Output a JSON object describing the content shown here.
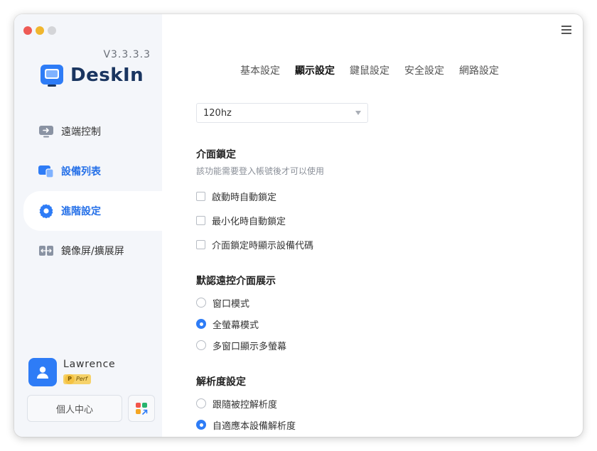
{
  "app": {
    "version": "V3.3.3.3",
    "brand_name": "DeskIn",
    "brand_color": "#2e7cf6"
  },
  "sidebar": {
    "items": [
      {
        "label": "遠端控制",
        "icon": "remote-screen-icon"
      },
      {
        "label": "設備列表",
        "icon": "devices-icon"
      },
      {
        "label": "進階設定",
        "icon": "gear-icon",
        "active": true
      },
      {
        "label": "鏡像屏/擴展屏",
        "icon": "mirror-extend-icon"
      }
    ]
  },
  "user": {
    "name": "Lawrence",
    "badge_letter": "P",
    "badge_text": "Perf",
    "profile_button": "個人中心",
    "apps_icon": "apps-grid-icon"
  },
  "header": {
    "menu_icon": "hamburger-menu-icon"
  },
  "tabs": [
    {
      "label": "基本設定"
    },
    {
      "label": "顯示設定",
      "active": true
    },
    {
      "label": "鍵鼠設定"
    },
    {
      "label": "安全設定"
    },
    {
      "label": "網路設定"
    }
  ],
  "display": {
    "refresh_rate_value": "120hz"
  },
  "lock": {
    "title": "介面鎖定",
    "description": "該功能需要登入帳號後才可以使用",
    "options": [
      {
        "label": "啟動時自動鎖定",
        "checked": false
      },
      {
        "label": "最小化時自動鎖定",
        "checked": false
      },
      {
        "label": "介面鎖定時顯示設備代碼",
        "checked": false
      }
    ]
  },
  "default_view": {
    "title": "默認遠控介面展示",
    "options": [
      {
        "label": "窗口模式",
        "selected": false
      },
      {
        "label": "全螢幕模式",
        "selected": true
      },
      {
        "label": "多窗口顯示多螢幕",
        "selected": false
      }
    ]
  },
  "resolution": {
    "title": "解析度設定",
    "options": [
      {
        "label": "跟隨被控解析度",
        "selected": false
      },
      {
        "label": "自適應本設備解析度",
        "selected": true
      }
    ]
  }
}
